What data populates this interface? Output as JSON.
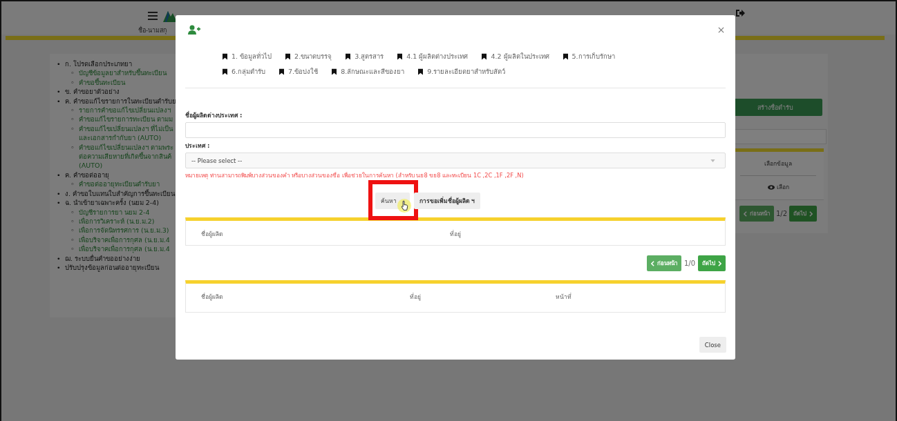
{
  "page": {
    "user_name": "ชื่อ-นามสกุ",
    "sidebar": {
      "items": [
        {
          "marker": "•",
          "text": "ก. โปรดเลือกประเภทยา",
          "children": [
            {
              "marker": "◦",
              "text": "บัญชีข้อมูลยาสำหรับขึ้นทะเบียน"
            },
            {
              "marker": "◦",
              "text": "คำขอขึ้นทะเบียน"
            }
          ]
        },
        {
          "marker": "•",
          "text": "ข. คำขอยาตัวอย่าง"
        },
        {
          "marker": "•",
          "text": "ค. คำขอแก้ไขรายการในทะเบียนตำรับย",
          "children": [
            {
              "marker": "◦",
              "text": "รายการคำขอแก้ไขเปลี่ยนแปลงฯ"
            },
            {
              "marker": "◦",
              "text": "คำขอแก้ไขรายการทะเบียน ตามม"
            },
            {
              "marker": "◦",
              "text": "คำขอแก้ไขเปลี่ยนแปลงฯ ที่ไม่เป็น\nและเอกสารกำกับยา (AUTO)"
            },
            {
              "marker": "◦",
              "text": "คำขอแก้ไขเปลี่ยนแปลงฯ ตามพระ\nต่อความเสียหายที่เกิดขึ้นจากสินค้\n(AUTO)"
            }
          ]
        },
        {
          "marker": "•",
          "text": "ค. คำขอต่ออายุ",
          "children": [
            {
              "marker": "◦",
              "text": "คำขอต่ออายุทะเบียนตำรับยา"
            }
          ]
        },
        {
          "marker": "•",
          "text": "ง. คำขอใบแทนใบสำคัญการขึ้นทะเบียน"
        },
        {
          "marker": "•",
          "text": "ฉ. นำเข้ายาเฉพาะครั้ง (นยม 2-4)",
          "children": [
            {
              "marker": "◦",
              "text": "บัญชีรายการยา นยม 2-4"
            },
            {
              "marker": "◦",
              "text": "เพื่อการวิเคราะห์ (น.ย.ม.2)"
            },
            {
              "marker": "◦",
              "text": "เพื่อการจัดนิทรรศการ (น.ย.ม.3)"
            },
            {
              "marker": "◦",
              "text": "เพื่อบริจาคเพื่อการกุศล (น.ย.ม.4"
            },
            {
              "marker": "◦",
              "text": "เพื่อบริจาคเพื่อการกุศล (น.ย.ม.4"
            }
          ]
        },
        {
          "marker": "•",
          "text": "ฌ. ระบบยื่นคำขออย่างง่าย"
        },
        {
          "marker": "•",
          "text": "ปรับปรุงข้อมูลก่อนต่ออายุทะเบียน"
        }
      ]
    },
    "panel": {
      "create_button": "สร้างชื่อตำรับ",
      "columns": [
        "เลือกข้อมูล"
      ],
      "rows": [
        {
          "action": "เลือก"
        }
      ],
      "pagination": {
        "previous": {
          "label": "ก่อนหน้า",
          "disabled": true
        },
        "page": "1/2",
        "next": {
          "label": "ถัดไป",
          "disabled": false
        }
      }
    }
  },
  "dialog": {
    "tabs": [
      {
        "label": "1. ข้อมูลทั่วไป"
      },
      {
        "label": "2.ขนาดบรรจุ"
      },
      {
        "label": "3.สูตรสาร"
      },
      {
        "label": "4.1 ผู้ผลิตต่างประเทศ"
      },
      {
        "label": "4.2 ผู้ผลิตในประเทศ"
      },
      {
        "label": "5.การเก็บรักษา"
      },
      {
        "label": "6.กลุ่มตำรับ"
      },
      {
        "label": "7.ข้อบ่งใช้"
      },
      {
        "label": "8.ลักษณะและสีของยา"
      },
      {
        "label": "9.รายละเอียดยาสำหรับสัตว์"
      }
    ],
    "fields": [
      {
        "kind": "text",
        "label": "ชื่อผู้ผลิตต่างประเทศ :"
      },
      {
        "kind": "select",
        "label": "ประเทศ :",
        "value": "-- Please select --"
      }
    ],
    "note": "หมายเหตุ ท่านสามารถพิมพ์บางส่วนของคำ หรือบางส่วนของชื่อ เพื่อช่วยในการค้นหา (สำหรับ นย8 ขย8 และทะเบียน 1C ,2C ,1F ,2F ,N)",
    "buttons": [
      {
        "label": "ค้นหา",
        "highlighted": true
      },
      {
        "label": "การขอเพิ่มชื่อผู้ผลิต ฯ",
        "highlighted": false
      }
    ],
    "results_table": {
      "columns": [
        "ชื่อผู้ผลิต",
        "ที่อยู่"
      ]
    },
    "pagination": {
      "previous": {
        "label": "ก่อนหน้า",
        "disabled": true
      },
      "page": "1/0",
      "next": {
        "label": "ถัดไป",
        "disabled": false
      }
    },
    "selected_table": {
      "columns": [
        "ชื่อผู้ผลิต",
        "ที่อยู่",
        "หน้าที่"
      ]
    },
    "close_button": "Close"
  }
}
